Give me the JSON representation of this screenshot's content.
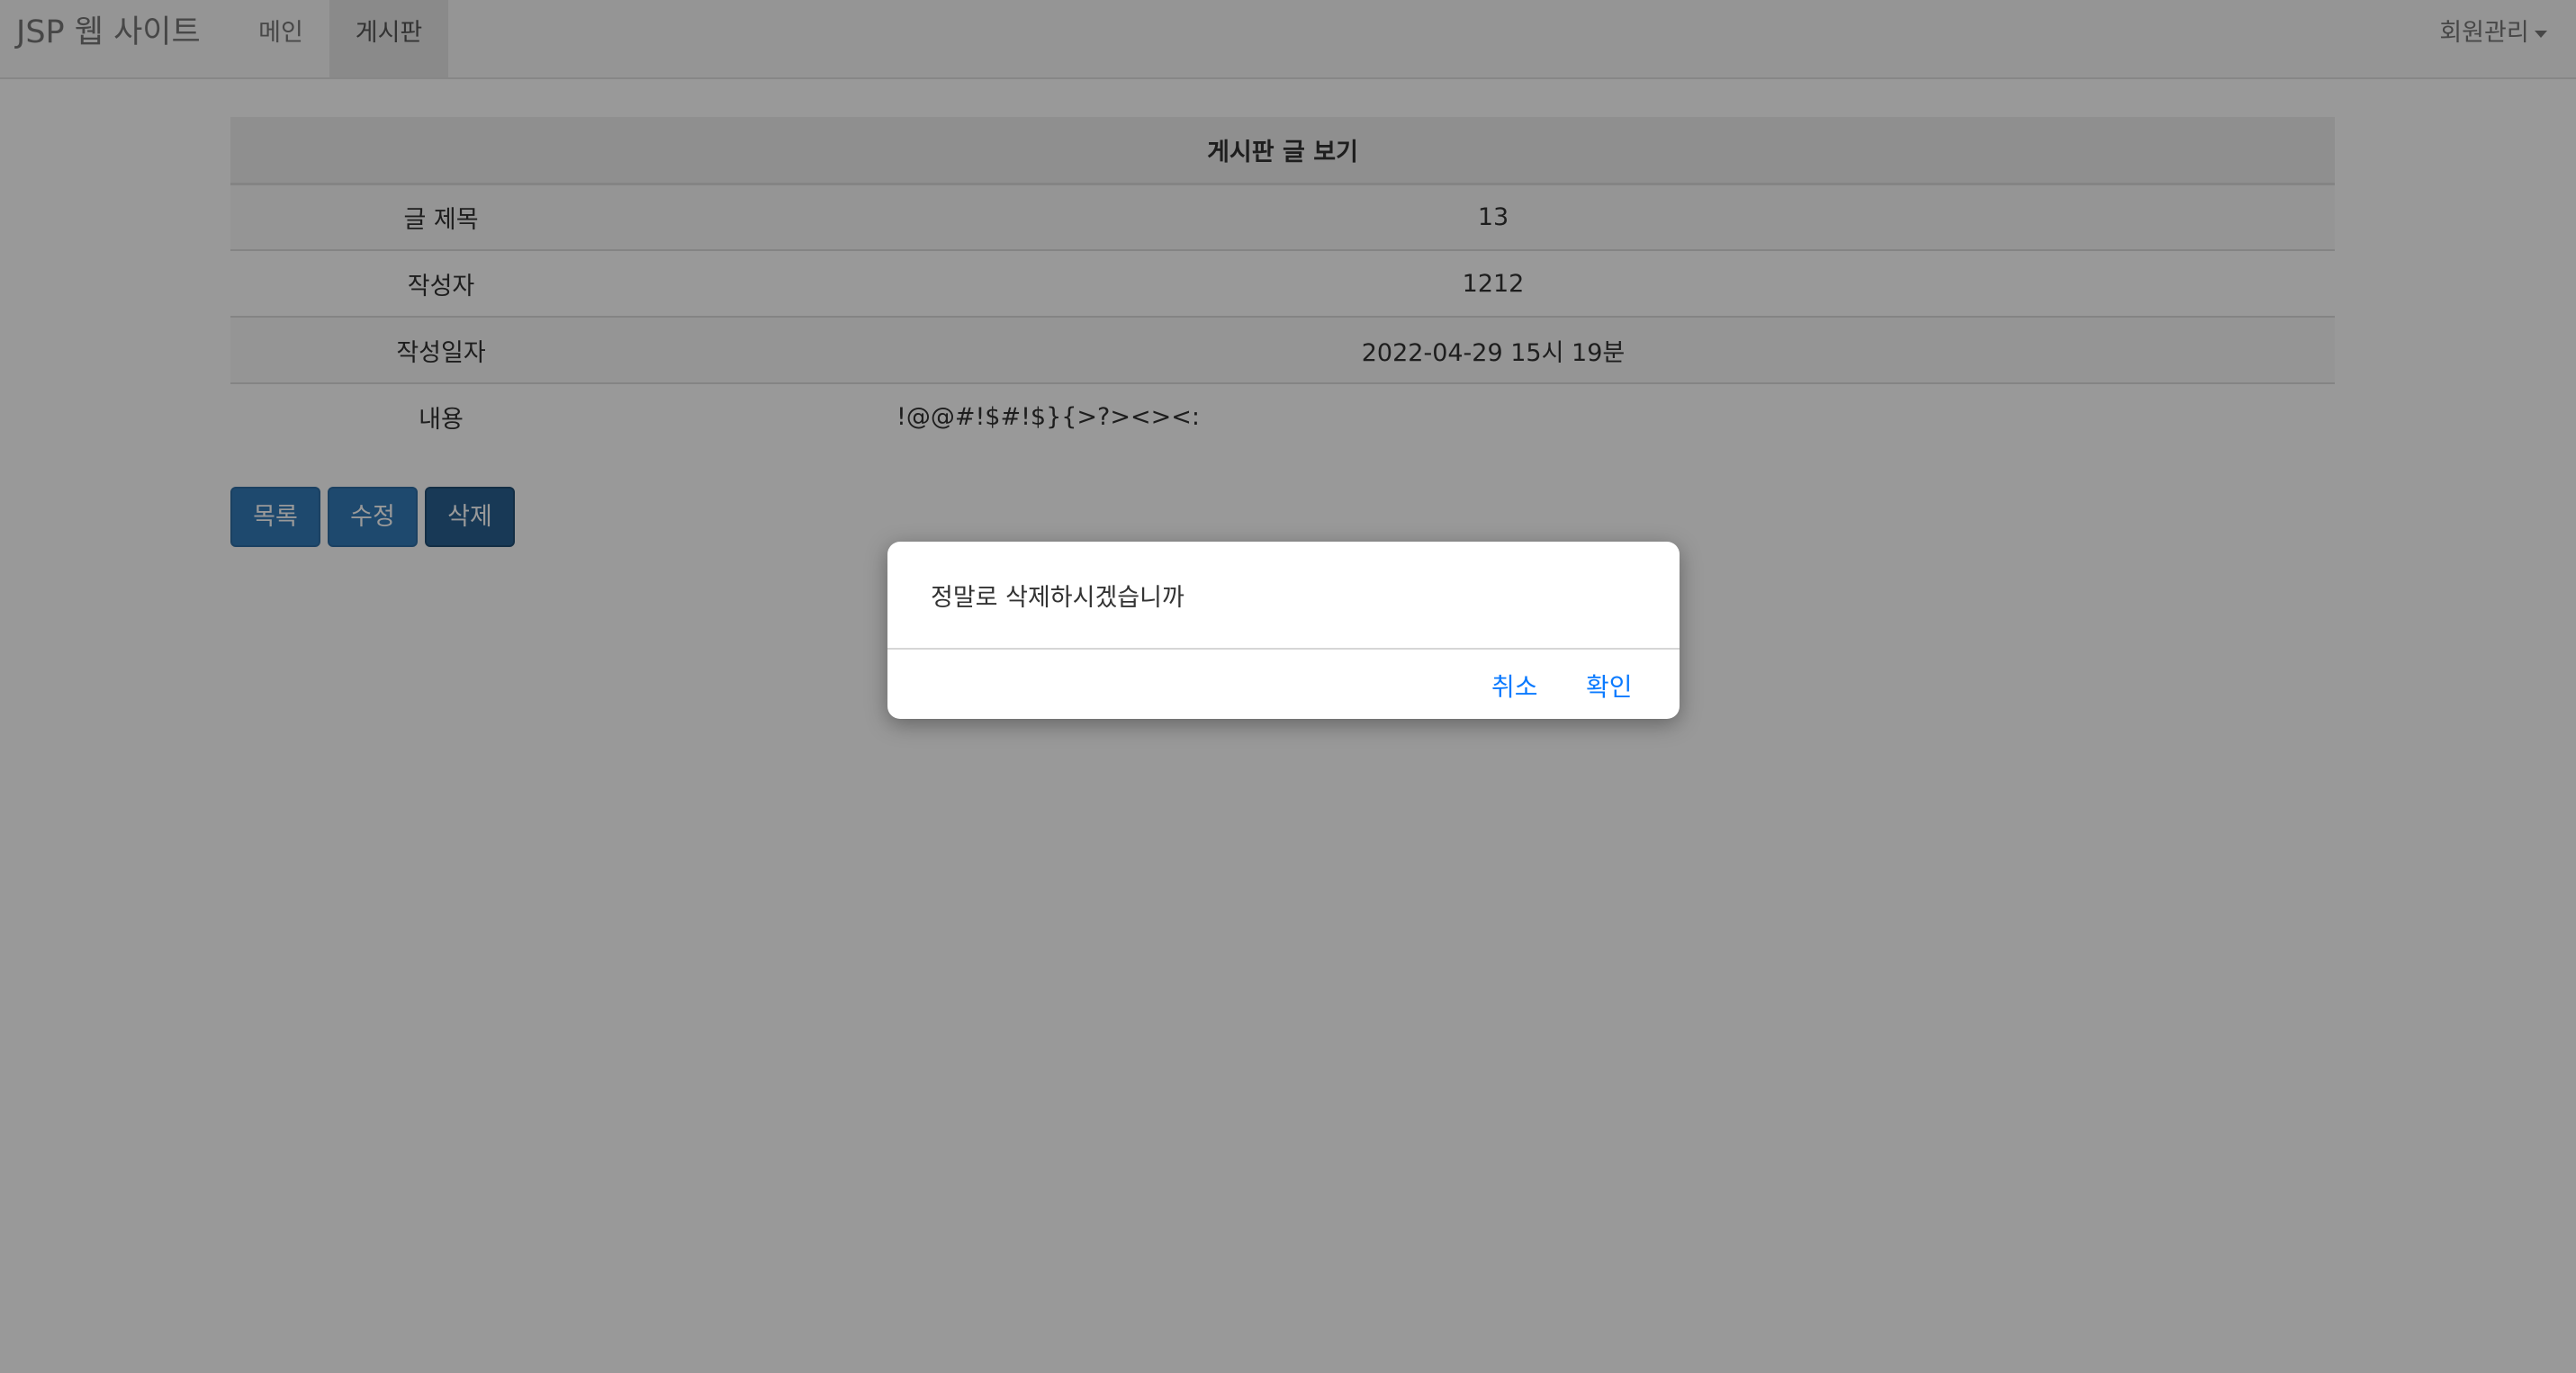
{
  "navbar": {
    "brand": "JSP 웹 사이트",
    "items": [
      {
        "label": "메인",
        "active": false
      },
      {
        "label": "게시판",
        "active": true
      }
    ],
    "member_menu": "회원관리"
  },
  "board_view": {
    "header": "게시판 글 보기",
    "rows": [
      {
        "label": "글 제목",
        "value": "13"
      },
      {
        "label": "작성자",
        "value": "1212"
      },
      {
        "label": "작성일자",
        "value": "2022-04-29 15시 19분"
      },
      {
        "label": "내용",
        "value": "!@@#!$#!$}{>?><><:"
      }
    ]
  },
  "buttons": {
    "list": "목록",
    "edit": "수정",
    "delete": "삭제"
  },
  "dialog": {
    "message": "정말로 삭제하시겠습니까",
    "cancel": "취소",
    "ok": "확인"
  },
  "colors": {
    "primary": "#337ab7",
    "dialog_button": "#0a7aff",
    "overlay": "rgba(0,0,0,0.4)"
  }
}
